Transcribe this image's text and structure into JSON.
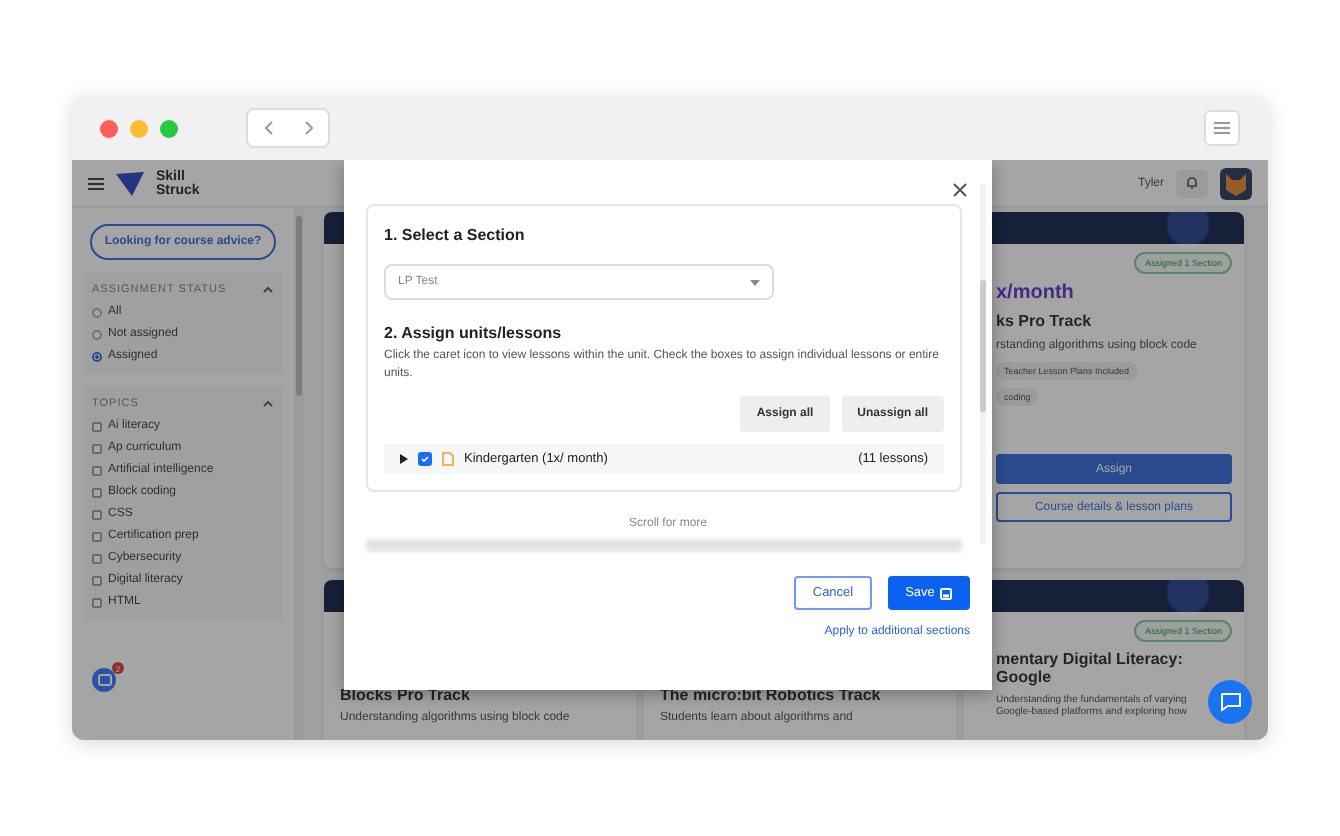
{
  "header": {
    "logo_lines": [
      "Skill",
      "Struck"
    ],
    "user": "Tyler"
  },
  "sidebar": {
    "advice_button": "Looking for course advice?",
    "sections": [
      {
        "title": "ASSIGNMENT STATUS",
        "kind": "radio",
        "expanded": true,
        "items": [
          {
            "label": "All",
            "selected": false
          },
          {
            "label": "Not assigned",
            "selected": false
          },
          {
            "label": "Assigned",
            "selected": true
          }
        ]
      },
      {
        "title": "TOPICS",
        "kind": "checkbox",
        "expanded": true,
        "items": [
          {
            "label": "Ai literacy",
            "checked": false
          },
          {
            "label": "Ap curriculum",
            "checked": false
          },
          {
            "label": "Artificial intelligence",
            "checked": false
          },
          {
            "label": "Block coding",
            "checked": false
          },
          {
            "label": "CSS",
            "checked": false
          },
          {
            "label": "Certification prep",
            "checked": false
          },
          {
            "label": "Cybersecurity",
            "checked": false
          },
          {
            "label": "Digital literacy",
            "checked": false
          },
          {
            "label": "HTML",
            "checked": false
          }
        ]
      }
    ],
    "widget_badge": "2"
  },
  "top_card": {
    "badge": "Assigned 1 Section",
    "price": "x/month",
    "title": "ks Pro Track",
    "description": "rstanding algorithms using block code",
    "tags": [
      "Teacher Lesson Plans Included",
      "coding"
    ],
    "assign_button": "Assign",
    "details_button": "Course details & lesson plans"
  },
  "bottom_cards": [
    {
      "kind": "plain",
      "title": "Blocks Pro Track",
      "description": "Understanding algorithms using block code"
    },
    {
      "kind": "plain",
      "title": "The micro:bit Robotics Track",
      "description": "Students learn about algorithms and"
    },
    {
      "kind": "assigned",
      "badge": "Assigned 1 Section",
      "title": "mentary Digital Literacy: Google",
      "description": "Understanding the fundamentals of varying Google-based platforms and exploring how"
    }
  ],
  "modal": {
    "step1_title": "1. Select a Section",
    "section_select": {
      "value": "LP Test"
    },
    "step2_title": "2. Assign units/lessons",
    "step2_help": "Click the caret icon to view lessons within the unit. Check the boxes to assign individual lessons or entire units.",
    "assign_all": "Assign all",
    "unassign_all": "Unassign all",
    "units": [
      {
        "name": "Kindergarten (1x/ month)",
        "lessons": "(11 lessons)",
        "checked": true,
        "expanded": false
      }
    ],
    "scroll_hint": "Scroll for more",
    "cancel": "Cancel",
    "save": "Save",
    "apply_link": "Apply to additional sections"
  }
}
